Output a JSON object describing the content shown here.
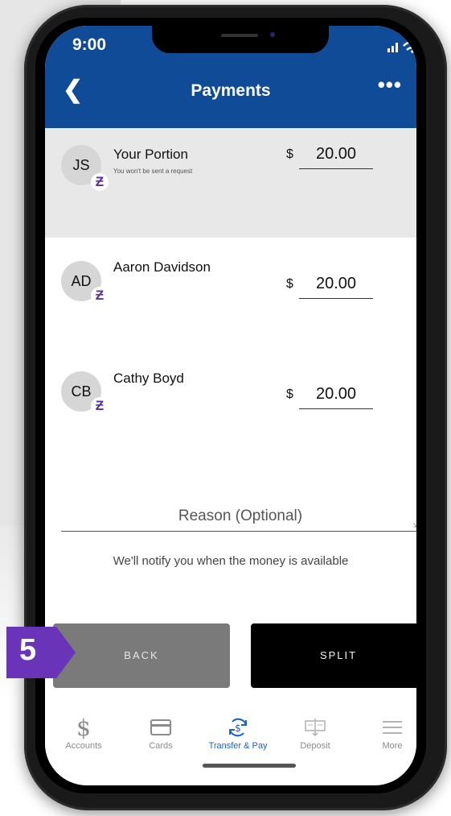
{
  "status_bar": {
    "time": "9:00"
  },
  "nav": {
    "back_icon": "chevron-left-icon",
    "title": "Payments",
    "more_icon": "ellipsis-icon"
  },
  "people": [
    {
      "initials": "JS",
      "name": "Your Portion",
      "sub": "You won't be sent a request",
      "currency": "$",
      "amount": "20.00"
    },
    {
      "initials": "AD",
      "name": "Aaron Davidson",
      "currency": "$",
      "amount": "20.00"
    },
    {
      "initials": "CB",
      "name": "Cathy Boyd",
      "currency": "$",
      "amount": "20.00"
    }
  ],
  "badge_icon": "zelle-icon",
  "reason": {
    "placeholder": "Reason (Optional)"
  },
  "notice": "We'll notify you when the money is available",
  "buttons": {
    "back": "BACK",
    "split": "SPLIT"
  },
  "tabs": [
    {
      "label": "Accounts",
      "icon": "dollar-icon"
    },
    {
      "label": "Cards",
      "icon": "card-icon"
    },
    {
      "label": "Transfer & Pay",
      "icon": "transfer-icon",
      "active": true
    },
    {
      "label": "Deposit",
      "icon": "check-deposit-icon"
    },
    {
      "label": "More",
      "icon": "menu-icon"
    }
  ],
  "step_marker": "5",
  "colors": {
    "header": "#0f4b97",
    "step": "#6a34b8",
    "active_tab": "#1763c8",
    "zelle": "#5b2ea6"
  }
}
